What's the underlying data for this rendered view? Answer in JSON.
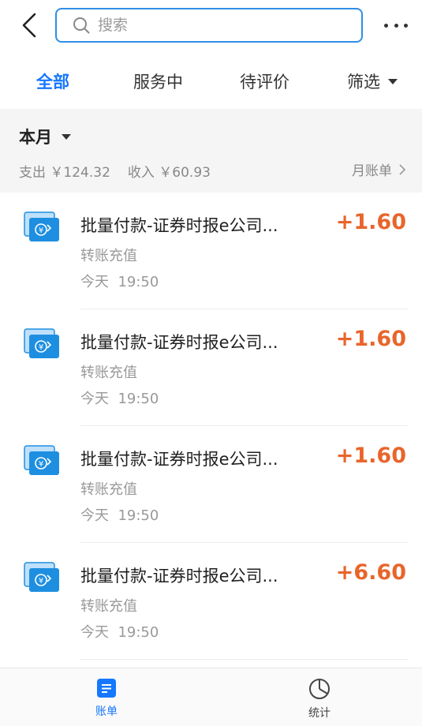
{
  "search": {
    "placeholder": "搜索"
  },
  "tabs": [
    {
      "label": "全部"
    },
    {
      "label": "服务中"
    },
    {
      "label": "待评价"
    },
    {
      "label": "筛选"
    }
  ],
  "summary": {
    "period": "本月",
    "expense": "支出 ￥124.32",
    "income": "收入 ￥60.93",
    "monthly_bill": "月账单"
  },
  "transactions": [
    {
      "title": "批量付款-证券时报e公司...",
      "category": "转账充值",
      "time": "今天  19:50",
      "amount": "+1.60"
    },
    {
      "title": "批量付款-证券时报e公司...",
      "category": "转账充值",
      "time": "今天  19:50",
      "amount": "+1.60"
    },
    {
      "title": "批量付款-证券时报e公司...",
      "category": "转账充值",
      "time": "今天  19:50",
      "amount": "+1.60"
    },
    {
      "title": "批量付款-证券时报e公司...",
      "category": "转账充值",
      "time": "今天  19:50",
      "amount": "+6.60"
    }
  ],
  "bottom_nav": [
    {
      "label": "账单",
      "icon": "bill-icon"
    },
    {
      "label": "统计",
      "icon": "pie-chart-icon"
    }
  ],
  "colors": {
    "accent": "#1677ff",
    "amount": "#e8652b",
    "icon_blue": "#1e8fe0"
  }
}
